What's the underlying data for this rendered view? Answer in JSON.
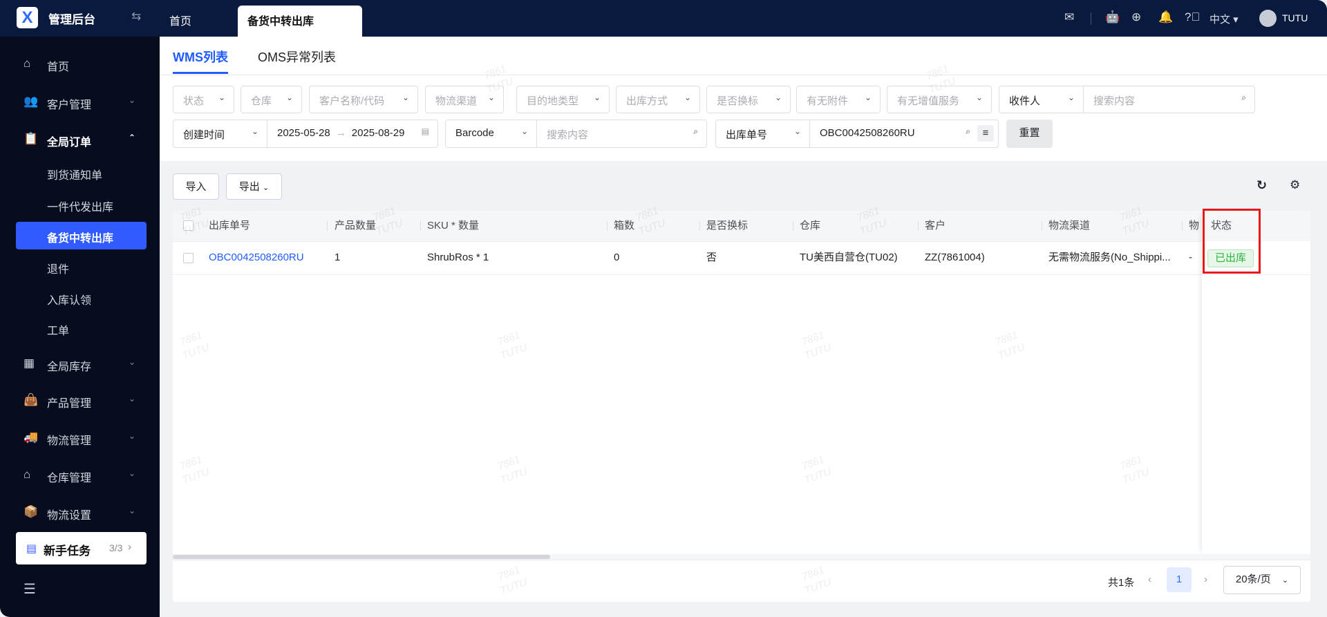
{
  "header": {
    "app_title": "管理后台",
    "tabs": [
      {
        "label": "首页"
      },
      {
        "label": "备货中转出库"
      }
    ],
    "language": "中文",
    "user": "TUTU"
  },
  "sidebar": {
    "items": [
      {
        "label": "首页"
      },
      {
        "label": "客户管理"
      },
      {
        "label": "全局订单"
      },
      {
        "label": "到货通知单"
      },
      {
        "label": "一件代发出库"
      },
      {
        "label": "备货中转出库"
      },
      {
        "label": "退件"
      },
      {
        "label": "入库认领"
      },
      {
        "label": "工单"
      },
      {
        "label": "全局库存"
      },
      {
        "label": "产品管理"
      },
      {
        "label": "物流管理"
      },
      {
        "label": "仓库管理"
      },
      {
        "label": "物流设置"
      }
    ],
    "task": {
      "label": "新手任务",
      "progress": "3/3"
    }
  },
  "subtabs": [
    {
      "label": "WMS列表"
    },
    {
      "label": "OMS异常列表"
    }
  ],
  "filters": {
    "row1": [
      "状态",
      "仓库",
      "客户名称/代码",
      "物流渠道",
      "目的地类型",
      "出库方式",
      "是否换标",
      "有无附件",
      "有无增值服务"
    ],
    "recipient_select": "收件人",
    "recipient_placeholder": "搜索内容",
    "time_select": "创建时间",
    "date_start": "2025-05-28",
    "date_end": "2025-08-29",
    "code_select": "Barcode",
    "code_placeholder": "搜索内容",
    "order_select": "出库单号",
    "order_value": "OBC0042508260RU",
    "reset": "重置"
  },
  "toolbar": {
    "import": "导入",
    "export": "导出"
  },
  "table": {
    "columns": [
      "出库单号",
      "产品数量",
      "SKU * 数量",
      "箱数",
      "是否换标",
      "仓库",
      "客户",
      "物流渠道",
      "物",
      "状态"
    ],
    "rows": [
      {
        "order_no": "OBC0042508260RU",
        "qty": "1",
        "sku": "ShrubRos * 1",
        "boxes": "0",
        "relabel": "否",
        "warehouse": "TU美西自营仓(TU02)",
        "customer": "ZZ(7861004)",
        "channel": "无需物流服务(No_Shippi...",
        "wu": "-",
        "status": "已出库"
      }
    ]
  },
  "pagination": {
    "total": "共1条",
    "current": "1",
    "page_size": "20条/页"
  },
  "watermark": {
    "line1": "7861",
    "line2": "TUTU"
  },
  "colors": {
    "accent": "#1f5bff",
    "header": "#0a1a3e",
    "sidebar": "#070d1f",
    "status_green": "#28b33a",
    "highlight": "#e81919"
  }
}
